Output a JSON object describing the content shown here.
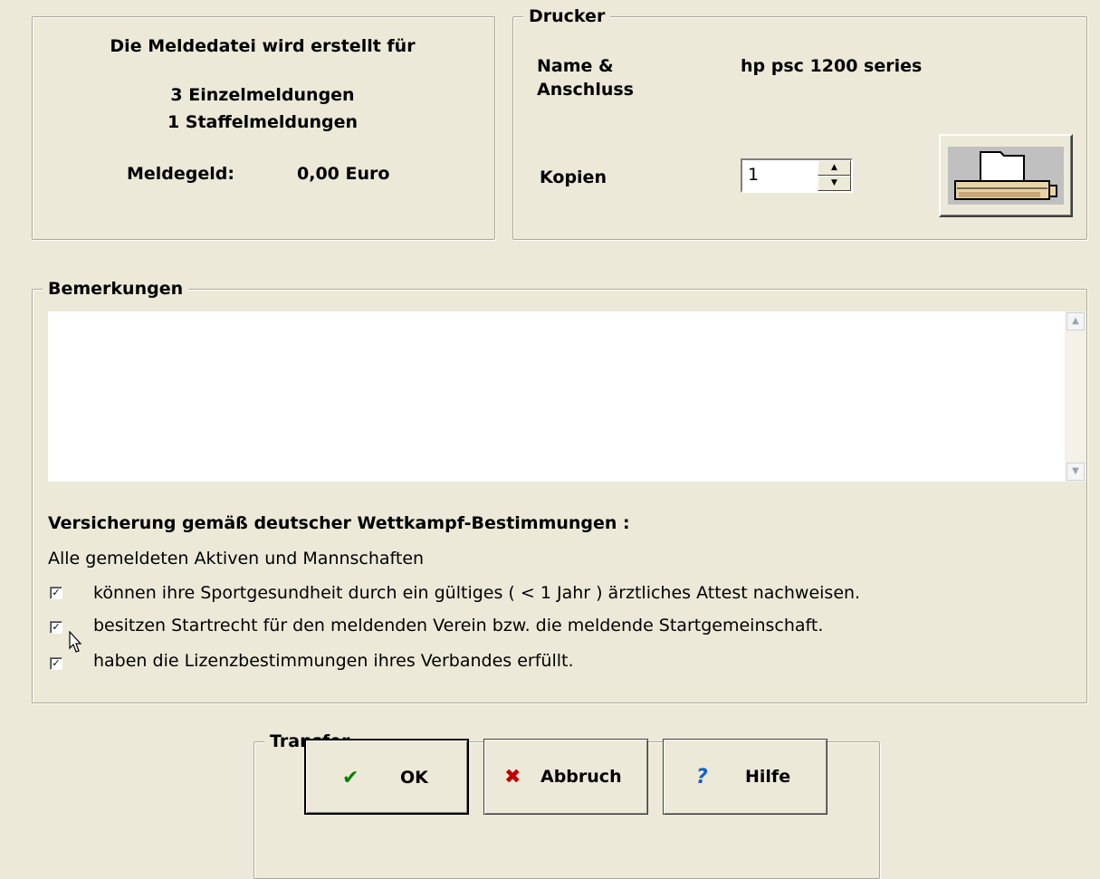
{
  "summary": {
    "heading": "Die Meldedatei wird erstellt für",
    "line1": "3 Einzelmeldungen",
    "line2": "1 Staffelmeldungen",
    "fee_label": "Meldegeld:",
    "fee_value": "0,00 Euro"
  },
  "printer": {
    "legend": "Drucker",
    "name_label_1": "Name &",
    "name_label_2": "Anschluss",
    "name_value": "hp psc 1200 series",
    "copies_label": "Kopien",
    "copies_value": "1"
  },
  "remarks": {
    "legend": "Bemerkungen",
    "text": ""
  },
  "insurance": {
    "heading": "Versicherung gemäß deutscher Wettkampf-Bestimmungen :",
    "intro": "Alle gemeldeten Aktiven und Mannschaften",
    "items": [
      {
        "label": "können ihre Sportgesundheit durch ein gültiges ( < 1 Jahr ) ärztliches Attest nachweisen.",
        "checked": true
      },
      {
        "label": "besitzen Startrecht für den meldenden Verein bzw. die meldende Startgemeinschaft.",
        "checked": true
      },
      {
        "label": "haben die Lizenzbestimmungen ihres Verbandes erfüllt.",
        "checked": true
      }
    ]
  },
  "transfer": {
    "legend": "Transfer",
    "ok_label": "OK",
    "cancel_label": "Abbruch",
    "help_label": "Hilfe",
    "ok_icon": "checkmark-icon",
    "cancel_icon": "x-icon",
    "help_icon": "question-icon",
    "ok_icon_color": "#008000",
    "cancel_icon_color": "#c00000",
    "help_icon_color": "#1060c8"
  }
}
